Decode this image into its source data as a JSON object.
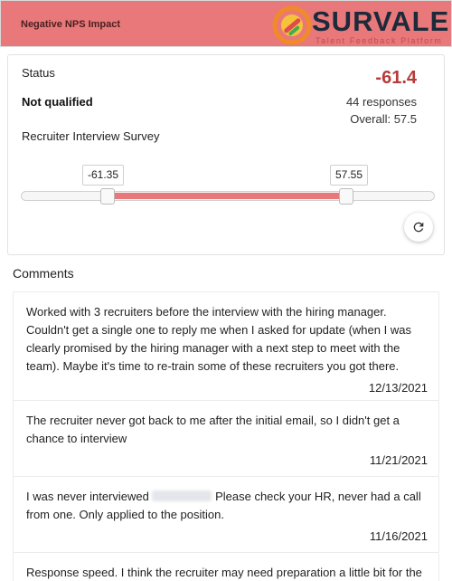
{
  "header": {
    "title": "Negative NPS Impact",
    "brand": {
      "name": "SURVALE",
      "tagline": "Talent Feedback Platform"
    }
  },
  "summary": {
    "status_label": "Status",
    "status_value": "Not qualified",
    "survey_name": "Recruiter Interview Survey",
    "score": "-61.4",
    "responses": "44 responses",
    "overall": "Overall: 57.5"
  },
  "range_slider": {
    "min_label": "-61.35",
    "max_label": "57.55",
    "low_fraction": 0.209,
    "high_fraction": 0.788
  },
  "colors": {
    "accent": "#e8787a",
    "score": "#b73a3a"
  },
  "comments": {
    "heading": "Comments",
    "items": [
      {
        "text": "Worked with 3 recruiters before the interview with the hiring manager. Couldn't get a single one to reply me when I asked for update (when I was clearly promised by the hiring manager with a next step to meet with the team). Maybe it's time to re-train some of these recruiters you got there.",
        "date": "12/13/2021"
      },
      {
        "text": "The recruiter never got back to me after the initial email, so I didn't get a chance to interview",
        "date": "11/21/2021"
      },
      {
        "text_before": "I was never interviewed",
        "text_after": "Please check your HR, never had a call from one. Only applied to the position.",
        "date": "11/16/2021"
      },
      {
        "text": "Response speed. I think the recruiter may need preparation a little bit for the"
      }
    ]
  }
}
